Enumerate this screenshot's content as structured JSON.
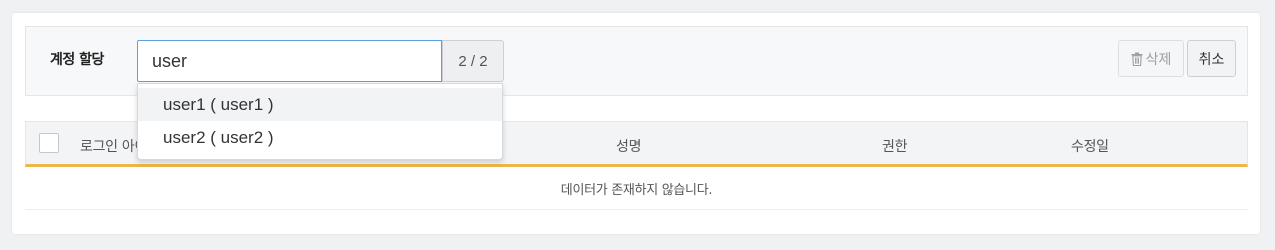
{
  "toolbar": {
    "label": "계정 할당",
    "search_value": "user",
    "count": "2 / 2",
    "delete_label": "삭제",
    "cancel_label": "취소"
  },
  "dropdown": {
    "items": [
      {
        "label": "user1 ( user1 )"
      },
      {
        "label": "user2 ( user2 )"
      }
    ]
  },
  "table": {
    "columns": [
      {
        "label": "로그인 아이디"
      },
      {
        "label": "성명"
      },
      {
        "label": "권한"
      },
      {
        "label": "수정일"
      }
    ],
    "empty_message": "데이터가 존재하지 않습니다."
  },
  "colors": {
    "accent": "#f0b64a",
    "input_focus": "#5aa0e0"
  }
}
